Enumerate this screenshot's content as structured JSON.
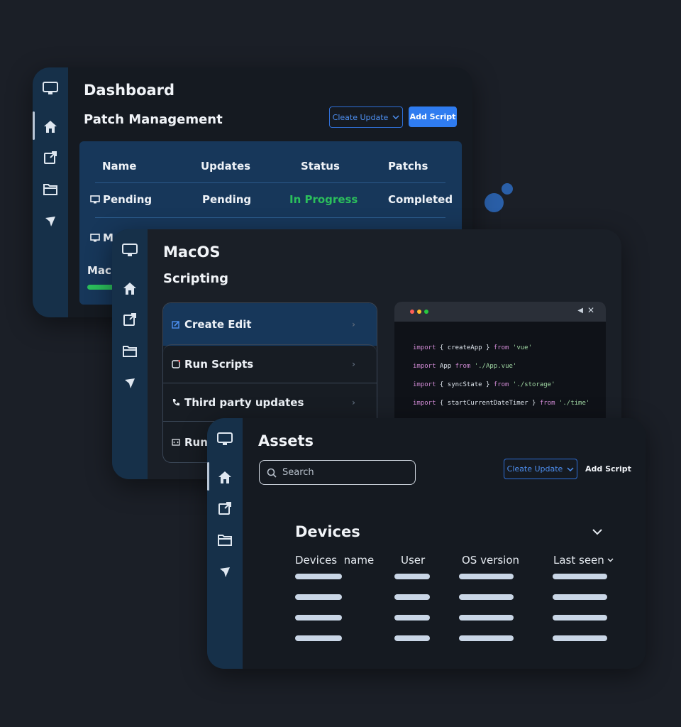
{
  "sidebar_icons": [
    "monitor-icon",
    "home-icon",
    "external-link-icon",
    "folder-icon",
    "send-icon"
  ],
  "dashboard": {
    "title": "Dashboard",
    "subtitle": "Patch Management",
    "create_update_label": "Cleate Update",
    "add_script_label": "Add Script",
    "columns": [
      "Name",
      "Updates",
      "Status",
      "Patchs"
    ],
    "rows": [
      {
        "name": "Pending",
        "updates": "Pending",
        "status": "In Progress",
        "patchs": "Completed"
      },
      {
        "name": "M",
        "updates": "",
        "status": "",
        "patchs": ""
      }
    ],
    "partial_label": "Mac",
    "status_color": "#2bbf5c"
  },
  "macos": {
    "title": "MacOS",
    "subtitle": "Scripting",
    "menu": [
      {
        "label": "Create Edit",
        "icon": "edit-icon"
      },
      {
        "label": "Run Scripts",
        "icon": "square-icon"
      },
      {
        "label": "Third party updates",
        "icon": "phone-icon"
      },
      {
        "label": "Run",
        "icon": "code-window-icon"
      }
    ],
    "code_lines": [
      {
        "a": "import",
        "b": " { createApp } ",
        "c": "from",
        "d": " 'vue'"
      },
      {
        "a": "import",
        "b": " App ",
        "c": "from",
        "d": " './App.vue'"
      },
      {
        "a": "import",
        "b": " { syncState } ",
        "c": "from",
        "d": " './storage'"
      },
      {
        "a": "import",
        "b": " { startCurrentDateTimer } ",
        "c": "from",
        "d": " './time'"
      }
    ]
  },
  "assets": {
    "title": "Assets",
    "search_placeholder": "Search",
    "create_update_label": "Cleate Update",
    "add_script_label": "Add Script",
    "section_title": "Devices",
    "columns": [
      "Devices  name",
      "User",
      "OS version",
      "Last seen"
    ]
  },
  "colors": {
    "accent": "#2f7cf0",
    "sidebar": "#163049",
    "success": "#2bbf5c"
  }
}
